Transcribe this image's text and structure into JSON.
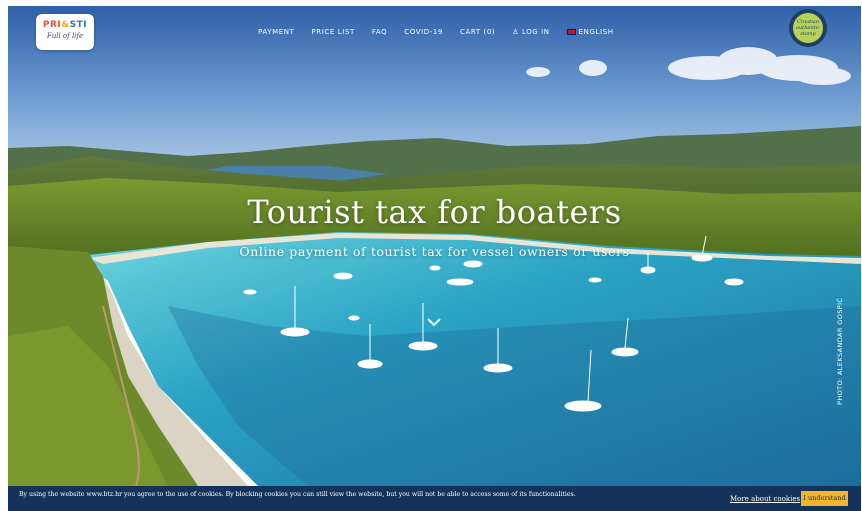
{
  "logo": {
    "letters": [
      "PRI",
      "&",
      "STI",
      "P"
    ],
    "tagline": "Full of life"
  },
  "nav": {
    "items": [
      "PAYMENT",
      "PRICE LIST",
      "FAQ",
      "COVID-19",
      "CART (0)",
      "LOG IN",
      "ENGLISH"
    ]
  },
  "badge": {
    "text": "Croatian authentic stamp"
  },
  "hero": {
    "title": "Tourist tax for boaters",
    "subtitle": "Online payment of tourist tax for vessel owners or users",
    "photo_credit": "PHOTO: ALEKSANDAR GOSPIĆ"
  },
  "cookie_bar": {
    "message": "By using the website www.btz.hr you agree to the use of cookies. By blocking cookies you can still view the website, but you will not be able to access some of its functionalities.",
    "more_link": "More about cookies",
    "accept_label": "I understand"
  },
  "colors": {
    "cookie_bg": "#15335a",
    "accept_button": "#f2b52f",
    "sea": "#2aa3c4"
  }
}
